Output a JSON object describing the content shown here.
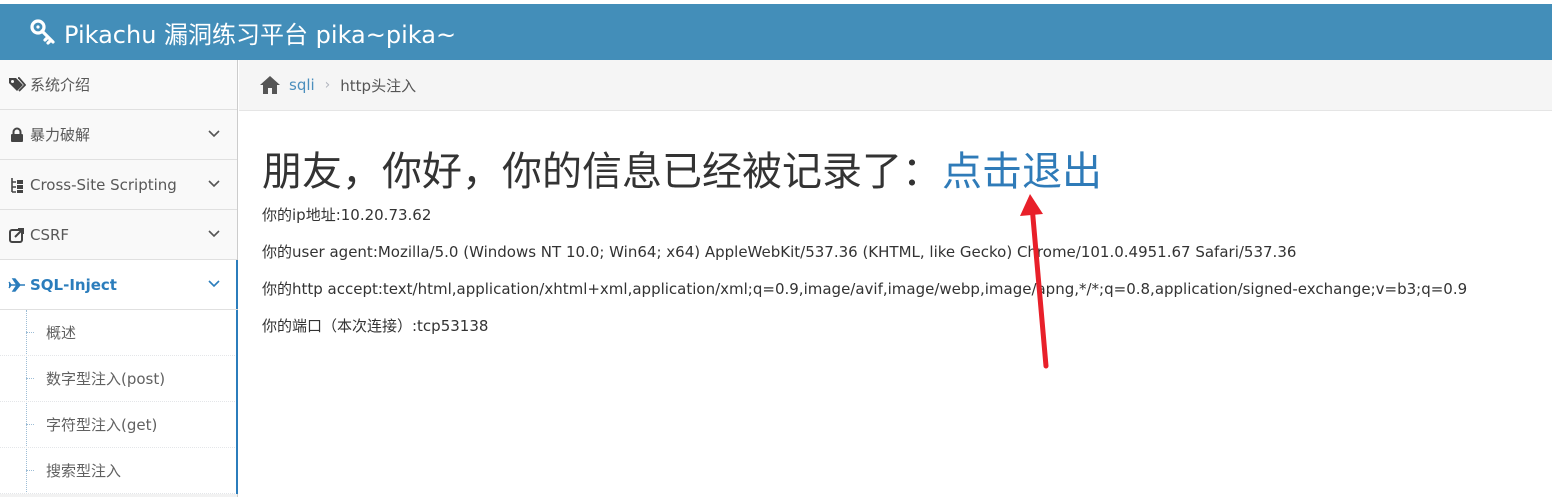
{
  "header": {
    "title": "Pikachu 漏洞练习平台 pika~pika~",
    "logo_icon": "key-icon"
  },
  "sidebar": {
    "items": [
      {
        "label": "系统介绍",
        "icon": "tags-icon",
        "expandable": false
      },
      {
        "label": "暴力破解",
        "icon": "lock-icon",
        "expandable": true
      },
      {
        "label": "Cross-Site Scripting",
        "icon": "sitemap-icon",
        "expandable": true
      },
      {
        "label": "CSRF",
        "icon": "share-icon",
        "expandable": true
      },
      {
        "label": "SQL-Inject",
        "icon": "plane-icon",
        "expandable": true,
        "active": true
      }
    ],
    "sub_items": [
      {
        "label": "概述"
      },
      {
        "label": "数字型注入(post)"
      },
      {
        "label": "字符型注入(get)"
      },
      {
        "label": "搜索型注入"
      }
    ]
  },
  "breadcrumb": {
    "link": "sqli",
    "separator": "›",
    "current": "http头注入"
  },
  "main": {
    "headline": "朋友，你好，你的信息已经被记录了：",
    "logout_link": "点击退出",
    "ip_line": "你的ip地址:10.20.73.62",
    "ua_line": "你的user agent:Mozilla/5.0 (Windows NT 10.0; Win64; x64) AppleWebKit/537.36 (KHTML, like Gecko) Chrome/101.0.4951.67 Safari/537.36",
    "accept_line": "你的http accept:text/html,application/xhtml+xml,application/xml;q=0.9,image/avif,image/webp,image/apng,*/*;q=0.8,application/signed-exchange;v=b3;q=0.9",
    "port_line": "你的端口（本次连接）:tcp53138"
  },
  "colors": {
    "header_bg": "#438eb9",
    "link": "#2f7bb8",
    "active_nav": "#2b7dbc",
    "annotation_arrow": "#e8202a"
  }
}
